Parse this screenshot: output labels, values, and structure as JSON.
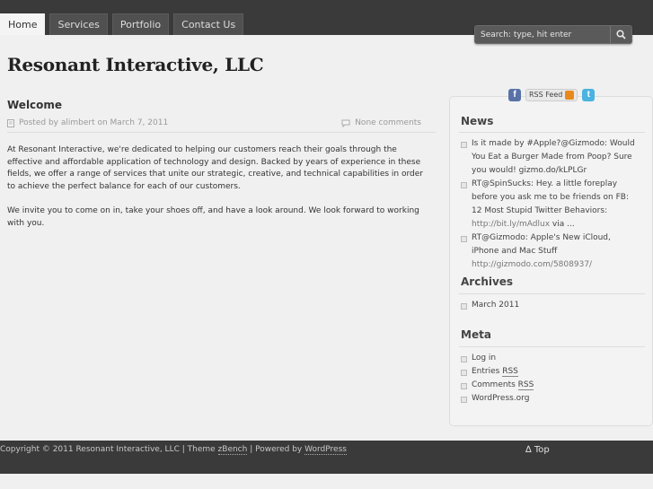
{
  "nav": {
    "items": [
      "Home",
      "Services",
      "Portfolio",
      "Contact Us"
    ]
  },
  "search": {
    "placeholder": "Search: type, hit enter"
  },
  "site": {
    "title": "Resonant Interactive, LLC"
  },
  "post": {
    "title": "Welcome",
    "meta": "Posted by alimbert on March 7, 2011",
    "comments": "None comments",
    "paragraphs": [
      "At Resonant Interactive, we're dedicated to helping our customers reach their goals through the effective and affordable application of technology and design. Backed by years of experience in these fields, we offer a range of services that unite our strategic, creative, and technical capabilities in order to achieve the perfect balance for each of our customers.",
      "We invite you to come on in, take your shoes off, and have a look around. We look forward to working with you."
    ]
  },
  "social": {
    "rss_label": "RSS Feed",
    "facebook_glyph": "f",
    "twitter_glyph": "t"
  },
  "sidebar": {
    "news": {
      "title": "News",
      "items": [
        {
          "text": "Is it made by #Apple?@Gizmodo: Would You Eat a Burger Made from Poop? Sure you would! gizmo.do/kLPLGr",
          "url": ""
        },
        {
          "text": "RT@SpinSucks: Hey. a little foreplay before you ask me to be friends on FB: 12 Most Stupid Twitter Behaviors: ",
          "url": "http://bit.ly/mAdlux",
          "tail": " via ..."
        },
        {
          "text": "RT@Gizmodo: Apple's New iCloud, iPhone and Mac Stuff ",
          "url": "http://gizmodo.com/5808937/"
        }
      ]
    },
    "archives": {
      "title": "Archives",
      "items": [
        "March 2011"
      ]
    },
    "meta": {
      "title": "Meta",
      "log_in": "Log in",
      "entries_prefix": "Entries ",
      "comments_prefix": "Comments ",
      "rss": "RSS",
      "wordpress": "WordPress.org"
    }
  },
  "footer": {
    "copyright": "Copyright © 2011 Resonant Interactive, LLC",
    "theme_prefix": "  |  Theme ",
    "theme_name": "zBench",
    "powered_prefix": "  |  Powered by ",
    "powered_name": "WordPress",
    "to_top": "∆ Top"
  },
  "colors": {
    "topbar": "#3a3a3a",
    "rss_orange": "#e9891c",
    "facebook_blue": "#5872a7",
    "twitter_blue": "#4ab3e0"
  }
}
